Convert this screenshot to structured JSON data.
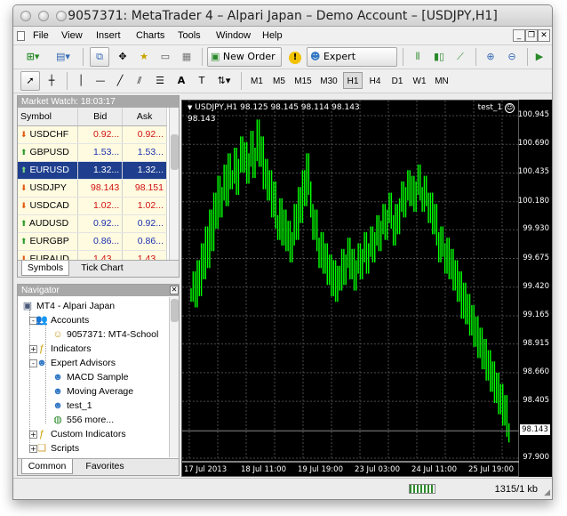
{
  "window": {
    "title": "9057371: MetaTrader 4 – Alpari Japan – Demo Account – [USDJPY,H1]"
  },
  "menu": [
    "File",
    "View",
    "Insert",
    "Charts",
    "Tools",
    "Window",
    "Help"
  ],
  "toolbar": {
    "new_order": "New Order",
    "expert_advisors": "Expert Advisors",
    "text_tool": "A"
  },
  "periods": [
    "M1",
    "M5",
    "M15",
    "M30",
    "H1",
    "H4",
    "D1",
    "W1",
    "MN"
  ],
  "selected_period": "H1",
  "market_watch": {
    "title": "Market Watch: 18:03:17",
    "columns": [
      "Symbol",
      "Bid",
      "Ask"
    ],
    "rows": [
      {
        "symbol": "USDCHF",
        "bid": "0.92...",
        "ask": "0.92...",
        "dir": "down"
      },
      {
        "symbol": "GBPUSD",
        "bid": "1.53...",
        "ask": "1.53...",
        "dir": "up"
      },
      {
        "symbol": "EURUSD",
        "bid": "1.32...",
        "ask": "1.32...",
        "dir": "up",
        "selected": true
      },
      {
        "symbol": "USDJPY",
        "bid": "98.143",
        "ask": "98.151",
        "dir": "down"
      },
      {
        "symbol": "USDCAD",
        "bid": "1.02...",
        "ask": "1.02...",
        "dir": "down"
      },
      {
        "symbol": "AUDUSD",
        "bid": "0.92...",
        "ask": "0.92...",
        "dir": "up"
      },
      {
        "symbol": "EURGBP",
        "bid": "0.86...",
        "ask": "0.86...",
        "dir": "up"
      },
      {
        "symbol": "EURAUD",
        "bid": "1.43...",
        "ask": "1.43...",
        "dir": "down"
      }
    ],
    "tabs": [
      "Symbols",
      "Tick Chart"
    ]
  },
  "navigator": {
    "title": "Navigator",
    "items": [
      {
        "label": "MT4 - Alpari Japan",
        "level": 0,
        "icon": "terminal-icon"
      },
      {
        "label": "Accounts",
        "level": 1,
        "icon": "accounts-icon",
        "toggle": "-"
      },
      {
        "label": "9057371: MT4-School",
        "level": 2,
        "icon": "user-icon"
      },
      {
        "label": "Indicators",
        "level": 1,
        "icon": "indicators-icon",
        "toggle": "+"
      },
      {
        "label": "Expert Advisors",
        "level": 1,
        "icon": "expert-advisors-icon",
        "toggle": "-"
      },
      {
        "label": "MACD Sample",
        "level": 2,
        "icon": "expert-icon"
      },
      {
        "label": "Moving Average",
        "level": 2,
        "icon": "expert-icon"
      },
      {
        "label": "test_1",
        "level": 2,
        "icon": "expert-icon"
      },
      {
        "label": "556 more...",
        "level": 2,
        "icon": "globe-icon"
      },
      {
        "label": "Custom Indicators",
        "level": 1,
        "icon": "custom-indicators-icon",
        "toggle": "+"
      },
      {
        "label": "Scripts",
        "level": 1,
        "icon": "scripts-icon",
        "toggle": "+"
      }
    ],
    "tabs": [
      "Common",
      "Favorites"
    ]
  },
  "chart": {
    "symbol_line": "USDJPY,H1  98.125 98.145 98.114 98.143",
    "price_line": "98.143",
    "expert_label": "test_1",
    "current_price": "98.143",
    "y_labels": [
      "100.945",
      "100.690",
      "100.435",
      "100.180",
      "99.930",
      "99.675",
      "99.420",
      "99.165",
      "98.915",
      "98.660",
      "98.405",
      "97.900"
    ],
    "x_labels": [
      "17 Jul 2013",
      "18 Jul 11:00",
      "19 Jul 19:00",
      "23 Jul 03:00",
      "24 Jul 11:00",
      "25 Jul 19:00"
    ],
    "bar_color": "#00ff00",
    "grid_color": "#4a4a4a"
  },
  "chart_data": {
    "type": "bar",
    "ylim": [
      97.9,
      101.0
    ],
    "series": [
      {
        "values": [
          99.35,
          99.5,
          99.3,
          99.6,
          99.4,
          99.75,
          99.55,
          99.9,
          99.65,
          100.05,
          99.8,
          100.2,
          100.0,
          100.35,
          100.1,
          100.25,
          100.45,
          100.2,
          100.55,
          100.35,
          100.4,
          100.6,
          100.3,
          100.5,
          100.7,
          100.5,
          100.65,
          100.4,
          100.55,
          100.75,
          100.45,
          100.6,
          100.85,
          100.55,
          100.7,
          100.35,
          100.5,
          100.25,
          100.4,
          100.1,
          100.3,
          100.0,
          99.9,
          100.15,
          99.85,
          100.05,
          99.8,
          99.95,
          99.7,
          99.85,
          100.1,
          99.9,
          100.25,
          100.05,
          100.4,
          100.2,
          100.55,
          100.3,
          100.1,
          99.9,
          100.05,
          99.8,
          99.65,
          99.85,
          99.6,
          99.75,
          99.5,
          99.65,
          99.4,
          99.6,
          99.35,
          99.55,
          99.45,
          99.7,
          99.5,
          99.65,
          99.8,
          99.55,
          99.7,
          99.45,
          99.6,
          99.75,
          99.55,
          99.7,
          99.85,
          99.6,
          99.75,
          99.9,
          99.7,
          99.85,
          100.0,
          99.8,
          99.95,
          100.1,
          99.9,
          100.05,
          100.2,
          100.0,
          99.85,
          100.1,
          99.95,
          100.15,
          100.3,
          100.1,
          100.25,
          100.4,
          100.2,
          100.35,
          100.15,
          100.3,
          100.45,
          100.25,
          100.15,
          100.35,
          100.2,
          100.05,
          100.2,
          99.95,
          100.1,
          99.85,
          99.7,
          99.9,
          99.75,
          99.6,
          99.8,
          99.55,
          99.7,
          99.45,
          99.6,
          99.35,
          99.5,
          99.2,
          99.4,
          99.15,
          99.3,
          99.05,
          99.2,
          98.95,
          99.1,
          98.85,
          99.0,
          98.75,
          98.9,
          98.65,
          98.8,
          98.55,
          98.7,
          98.45,
          98.6,
          98.35,
          98.5,
          98.25,
          98.4,
          98.15,
          98.1
        ]
      }
    ]
  },
  "statusbar": {
    "traffic": "1315/1 kb"
  }
}
